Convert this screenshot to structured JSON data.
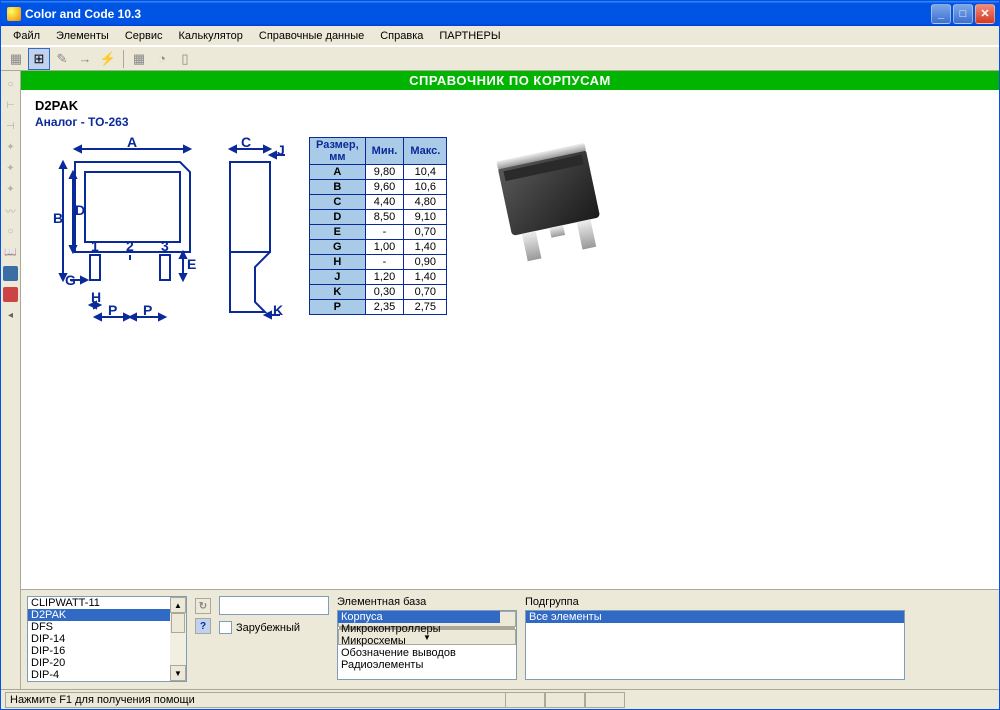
{
  "window": {
    "title": "Color and Code 10.3"
  },
  "menu": {
    "file": "Файл",
    "elements": "Элементы",
    "service": "Сервис",
    "calculator": "Калькулятор",
    "refdata": "Справочные данные",
    "help": "Справка",
    "partners": "ПАРТНЕРЫ"
  },
  "header": {
    "title": "СПРАВОЧНИК ПО КОРПУСАМ"
  },
  "package": {
    "name": "D2PAK",
    "analog_label": "Аналог - TO-263"
  },
  "dim_headers": {
    "size": "Размер, мм",
    "min": "Мин.",
    "max": "Макс."
  },
  "dims": [
    {
      "k": "A",
      "min": "9,80",
      "max": "10,4"
    },
    {
      "k": "B",
      "min": "9,60",
      "max": "10,6"
    },
    {
      "k": "C",
      "min": "4,40",
      "max": "4,80"
    },
    {
      "k": "D",
      "min": "8,50",
      "max": "9,10"
    },
    {
      "k": "E",
      "min": "-",
      "max": "0,70"
    },
    {
      "k": "G",
      "min": "1,00",
      "max": "1,40"
    },
    {
      "k": "H",
      "min": "-",
      "max": "0,90"
    },
    {
      "k": "J",
      "min": "1,20",
      "max": "1,40"
    },
    {
      "k": "K",
      "min": "0,30",
      "max": "0,70"
    },
    {
      "k": "P",
      "min": "2,35",
      "max": "2,75"
    }
  ],
  "diagram_labels": {
    "A": "A",
    "B": "B",
    "C": "C",
    "D": "D",
    "E": "E",
    "G": "G",
    "H": "H",
    "J": "J",
    "K": "K",
    "P": "P",
    "n1": "1",
    "n2": "2",
    "n3": "3"
  },
  "bottom": {
    "package_list": [
      "CLIPWATT-11",
      "D2PAK",
      "DFS",
      "DIP-14",
      "DIP-16",
      "DIP-20",
      "DIP-4"
    ],
    "package_selected": "D2PAK",
    "foreign_label": "Зарубежный",
    "base_label": "Элементная база",
    "base_items": [
      "Корпуса",
      "Микроконтроллеры",
      "Микросхемы",
      "Обозначение выводов",
      "Радиоэлементы"
    ],
    "base_selected": "Корпуса",
    "subgroup_label": "Подгруппа",
    "subgroup_items": [
      "Все элементы"
    ],
    "subgroup_selected": "Все элементы"
  },
  "status": {
    "text": "Нажмите F1 для получения помощи"
  }
}
